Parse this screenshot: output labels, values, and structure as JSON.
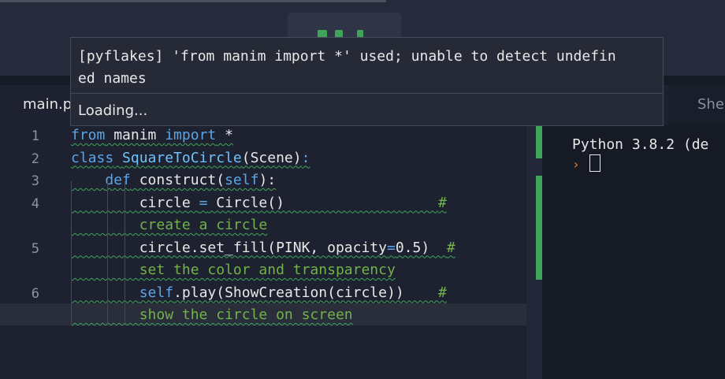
{
  "tabs": {
    "main": "main.p",
    "shell": "She"
  },
  "editor": {
    "line_numbers": [
      "1",
      "2",
      "3",
      "4",
      "5",
      "6"
    ],
    "lines": [
      {
        "parts": [
          [
            "kw",
            "from"
          ],
          [
            "fn",
            " manim "
          ],
          [
            "kw",
            "import"
          ],
          [
            "fn",
            " *"
          ]
        ]
      },
      {
        "parts": [
          [
            "kw",
            "class"
          ],
          [
            "fn",
            " "
          ],
          [
            "cls",
            "SquareToCircle"
          ],
          [
            "fn",
            "(Scene)"
          ],
          [
            "kw",
            ":"
          ]
        ]
      },
      {
        "parts": [
          [
            "fn",
            "    "
          ],
          [
            "kw",
            "def"
          ],
          [
            "fn",
            " construct("
          ],
          [
            "kw",
            "self"
          ],
          [
            "fn",
            "):"
          ]
        ]
      },
      {
        "parts": [
          [
            "fn",
            "        circle "
          ],
          [
            "kw",
            "="
          ],
          [
            "fn",
            " Circle()                  "
          ],
          [
            "cm",
            "#"
          ]
        ]
      },
      {
        "parts": [
          [
            "cm",
            "        create a circle"
          ]
        ]
      },
      {
        "parts": [
          [
            "fn",
            "        circle.set_fill(PINK, opacity"
          ],
          [
            "kw",
            "="
          ],
          [
            "fn",
            "0.5)  "
          ],
          [
            "cm",
            "#"
          ]
        ]
      },
      {
        "parts": [
          [
            "cm",
            "        set the color and transparency"
          ]
        ]
      },
      {
        "parts": [
          [
            "fn",
            "        "
          ],
          [
            "kw",
            "self"
          ],
          [
            "fn",
            ".play(ShowCreation(circle))    "
          ],
          [
            "cm",
            "#"
          ]
        ]
      },
      {
        "parts": [
          [
            "cm",
            "        show the circle on screen"
          ]
        ]
      }
    ]
  },
  "shell": {
    "version_text": "Python 3.8.2 (de",
    "prompt": "›"
  },
  "tooltip": {
    "message_line1": "[pyflakes] 'from manim import *' used; unable to detect undefin",
    "message_line2": "ed names",
    "loading": "Loading..."
  },
  "colors": {
    "accent_green": "#3fa55a",
    "keyword": "#5aa5e8",
    "comment": "#6fb34a",
    "prompt": "#f07a23"
  }
}
